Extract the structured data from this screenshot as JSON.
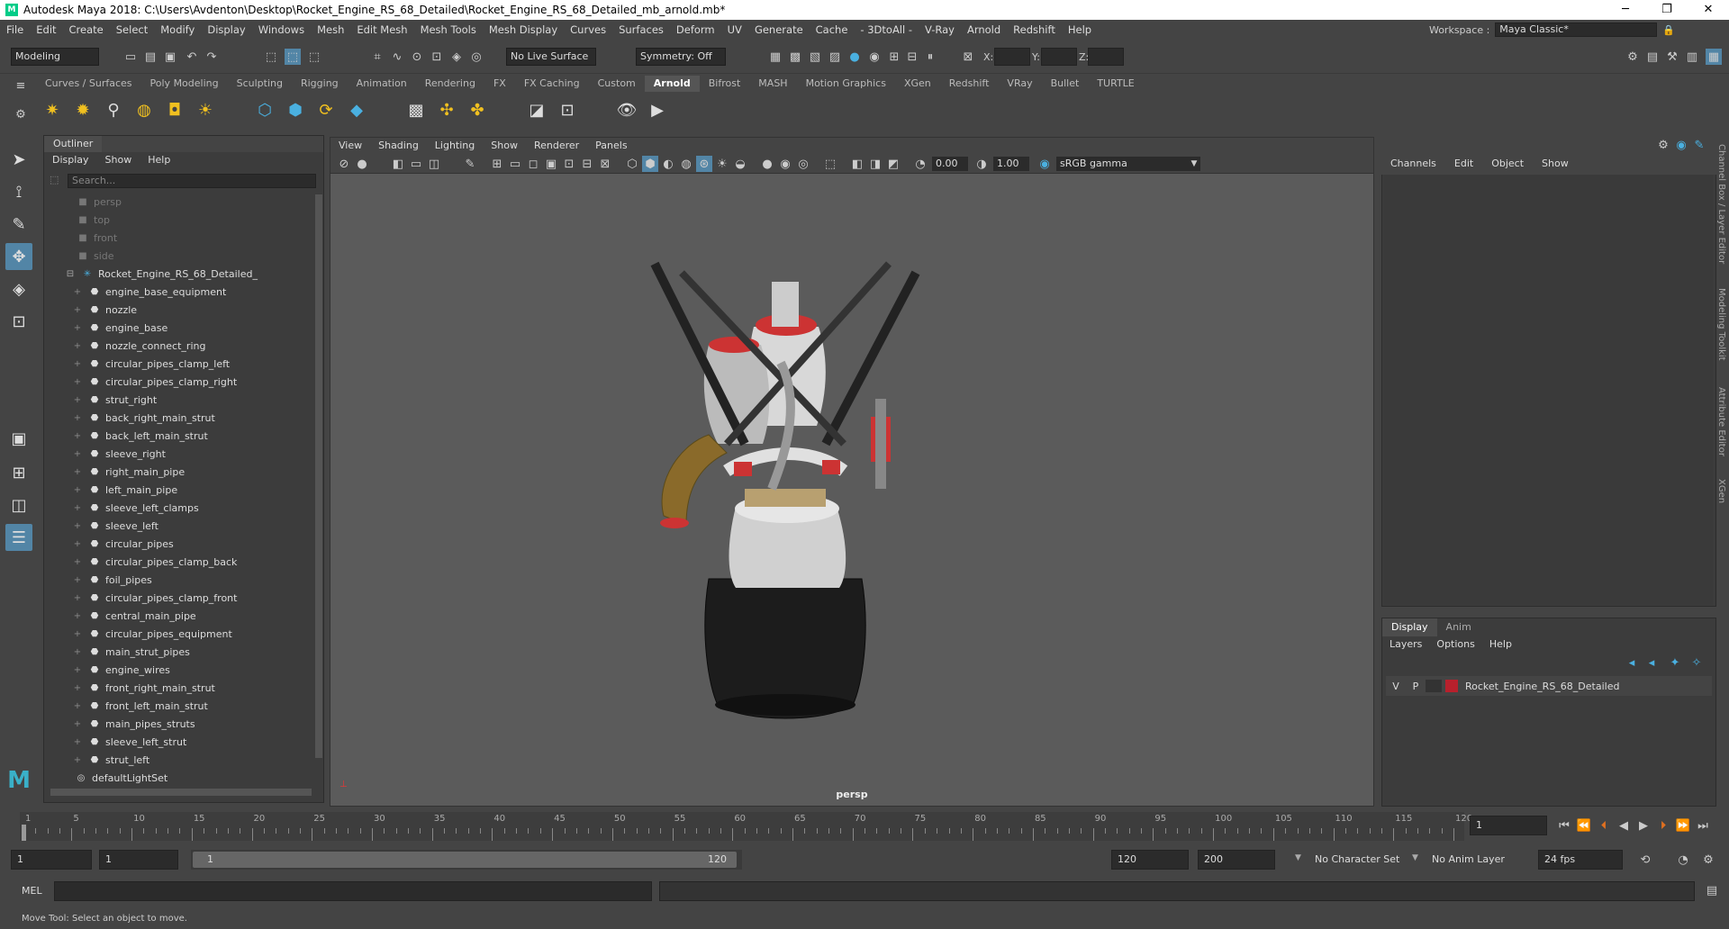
{
  "window": {
    "title": "Autodesk Maya 2018: C:\\Users\\Avdenton\\Desktop\\Rocket_Engine_RS_68_Detailed\\Rocket_Engine_RS_68_Detailed_mb_arnold.mb*",
    "minimize": "─",
    "maximize": "❐",
    "close": "✕"
  },
  "menubar": {
    "items": [
      "File",
      "Edit",
      "Create",
      "Select",
      "Modify",
      "Display",
      "Windows",
      "Mesh",
      "Edit Mesh",
      "Mesh Tools",
      "Mesh Display",
      "Curves",
      "Surfaces",
      "Deform",
      "UV",
      "Generate",
      "Cache",
      "- 3DtoAll -",
      "V-Ray",
      "Arnold",
      "Redshift",
      "Help"
    ],
    "workspace_label": "Workspace :",
    "workspace_value": "Maya Classic*"
  },
  "statusline": {
    "mode": "Modeling",
    "live_surface": "No Live Surface",
    "symmetry": "Symmetry: Off",
    "x_label": "X:",
    "y_label": "Y:",
    "z_label": "Z:"
  },
  "shelf": {
    "tabs": [
      "Curves / Surfaces",
      "Poly Modeling",
      "Sculpting",
      "Rigging",
      "Animation",
      "Rendering",
      "FX",
      "FX Caching",
      "Custom",
      "Arnold",
      "Bifrost",
      "MASH",
      "Motion Graphics",
      "XGen",
      "Redshift",
      "VRay",
      "Bullet",
      "TURTLE"
    ],
    "active_tab": "Arnold"
  },
  "outliner": {
    "title": "Outliner",
    "menu": [
      "Display",
      "Show",
      "Help"
    ],
    "search_placeholder": "Search...",
    "cameras": [
      "persp",
      "top",
      "front",
      "side"
    ],
    "root": "Rocket_Engine_RS_68_Detailed_",
    "children": [
      "engine_base_equipment",
      "nozzle",
      "engine_base",
      "nozzle_connect_ring",
      "circular_pipes_clamp_left",
      "circular_pipes_clamp_right",
      "strut_right",
      "back_right_main_strut",
      "back_left_main_strut",
      "sleeve_right",
      "right_main_pipe",
      "left_main_pipe",
      "sleeve_left_clamps",
      "sleeve_left",
      "circular_pipes",
      "circular_pipes_clamp_back",
      "foil_pipes",
      "circular_pipes_clamp_front",
      "central_main_pipe",
      "circular_pipes_equipment",
      "main_strut_pipes",
      "engine_wires",
      "front_right_main_strut",
      "front_left_main_strut",
      "main_pipes_struts",
      "sleeve_left_strut",
      "strut_left"
    ],
    "light_set": "defaultLightSet"
  },
  "viewport": {
    "menu": [
      "View",
      "Shading",
      "Lighting",
      "Show",
      "Renderer",
      "Panels"
    ],
    "exposure": "0.00",
    "gamma": "1.00",
    "color_space": "sRGB gamma",
    "camera_label": "persp"
  },
  "channelbox": {
    "menu": [
      "Channels",
      "Edit",
      "Object",
      "Show"
    ]
  },
  "layer_editor": {
    "tabs": [
      "Display",
      "Anim"
    ],
    "active_tab": "Display",
    "menu": [
      "Layers",
      "Options",
      "Help"
    ],
    "layer": {
      "v": "V",
      "p": "P",
      "name": "Rocket_Engine_RS_68_Detailed",
      "color": "#b8202c"
    }
  },
  "side_tabs": [
    "Channel Box / Layer Editor",
    "Modeling Toolkit",
    "Attribute Editor",
    "XGen"
  ],
  "timeline": {
    "ticks": [
      1,
      5,
      10,
      15,
      20,
      25,
      30,
      35,
      40,
      45,
      50,
      55,
      60,
      65,
      70,
      75,
      80,
      85,
      90,
      95,
      100,
      105,
      110,
      115,
      120
    ],
    "current_frame": "1"
  },
  "range": {
    "start": "1",
    "playback_start": "1",
    "slider_start": "1",
    "slider_end": "120",
    "playback_end": "120",
    "end": "200",
    "character_set": "No Character Set",
    "anim_layer": "No Anim Layer",
    "fps": "24 fps"
  },
  "mel": {
    "label": "MEL"
  },
  "help": {
    "text": "Move Tool: Select an object to move."
  },
  "colors": {
    "accent": "#5285a6",
    "bg": "#444444",
    "viewport": "#5b5b5b"
  }
}
